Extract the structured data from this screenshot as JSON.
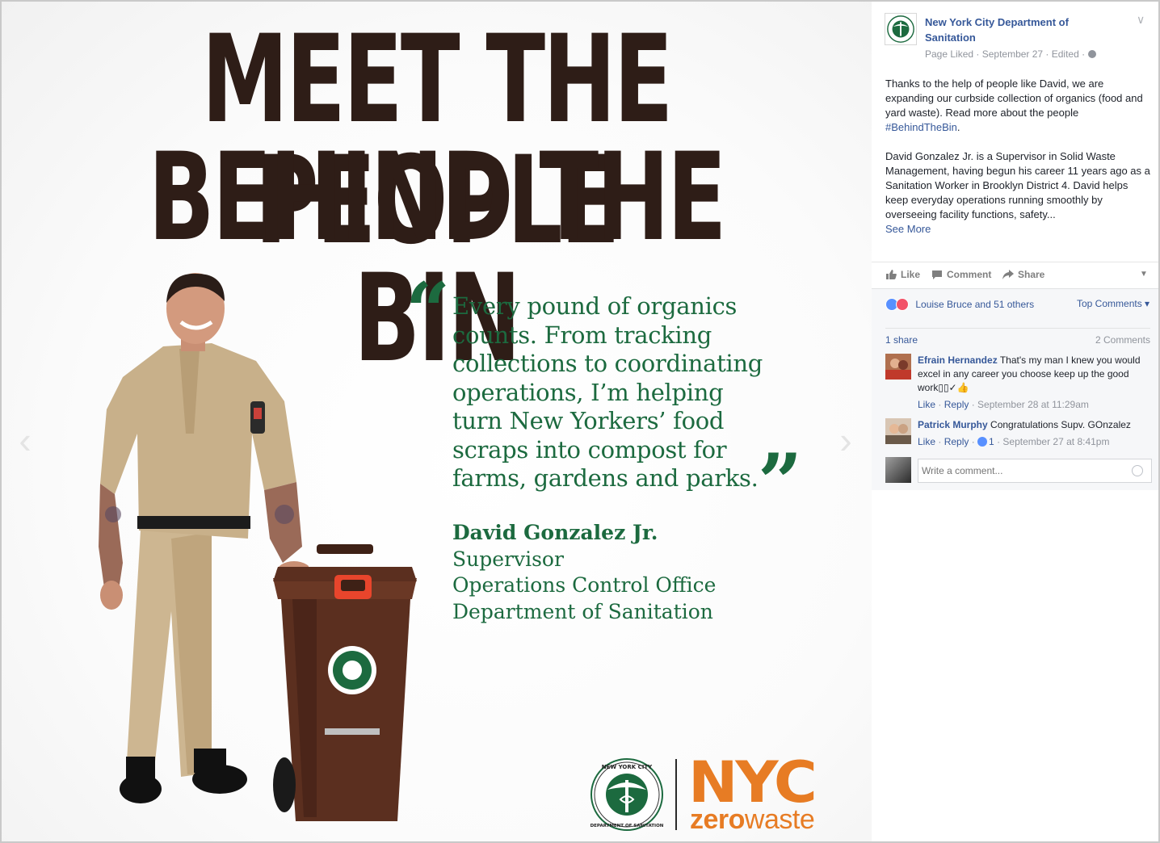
{
  "photo": {
    "headline_line1": "MEET THE PEOPLE",
    "headline_line2": "BEHIND THE BIN",
    "quote_open": "“",
    "quote_close": "”",
    "quote_lines": [
      "Every pound of organics",
      "counts.  From tracking",
      "collections to coordinating",
      "operations, I’m helping",
      "turn New Yorkers’ food",
      "scraps into compost for",
      "farms, gardens and parks."
    ],
    "attribution": {
      "name": "David Gonzalez Jr.",
      "role1": "Supervisor",
      "role2": "Operations Control Office",
      "role3": "Department of Sanitation"
    },
    "seal_text_top": "NEW YORK CITY",
    "seal_text_bottom": "DEPARTMENT OF SANITATION",
    "nyc_logo": "NYC",
    "zero_logo_bold": "zero",
    "zero_logo_rest": "waste",
    "nav_prev_icon": "chevron-left-icon",
    "nav_next_icon": "chevron-right-icon"
  },
  "post": {
    "page_name": "New York City Department of Sanitation",
    "meta": "Page Liked · September 27 · Edited ·",
    "paragraph1_text": "Thanks to the help of people like David, we are expanding our curbside collection of organics (food and yard waste). Read more about the people ",
    "hashtag": "#BehindTheBin",
    "paragraph1_end": ".",
    "paragraph2_text": "David Gonzalez Jr. is a Supervisor in Solid Waste Management, having begun his career 11 years ago as a Sanitation Worker in Brooklyn District 4. David helps keep everyday operations running smoothly by overseeing facility functions, safety...",
    "see_more": "See More"
  },
  "actions": {
    "like": "Like",
    "comment": "Comment",
    "share": "Share"
  },
  "reactions": {
    "summary": "Louise Bruce and 51 others",
    "top_comments": "Top Comments ▾",
    "shares": "1 share",
    "comments_count": "2 Comments"
  },
  "comments": [
    {
      "author": "Efrain Hernandez",
      "text": " That's my man I knew you would excel in any career you choose keep up the good work▯▯✓👍",
      "like": "Like",
      "reply": "Reply",
      "time": " · September 28 at 11:29am"
    },
    {
      "author": "Patrick Murphy",
      "text": " Congratulations Supv. GOnzalez",
      "like": "Like",
      "reply": "Reply",
      "likes": "1",
      "time": " · September 27 at 8:41pm"
    }
  ],
  "write_comment": {
    "placeholder": "Write a comment..."
  },
  "colors": {
    "headline": "#2e1d17",
    "quote_green": "#1c6a3f",
    "nyc_orange": "#e77c24",
    "fb_link": "#365899",
    "bin_brown": "#5b2f1f"
  }
}
